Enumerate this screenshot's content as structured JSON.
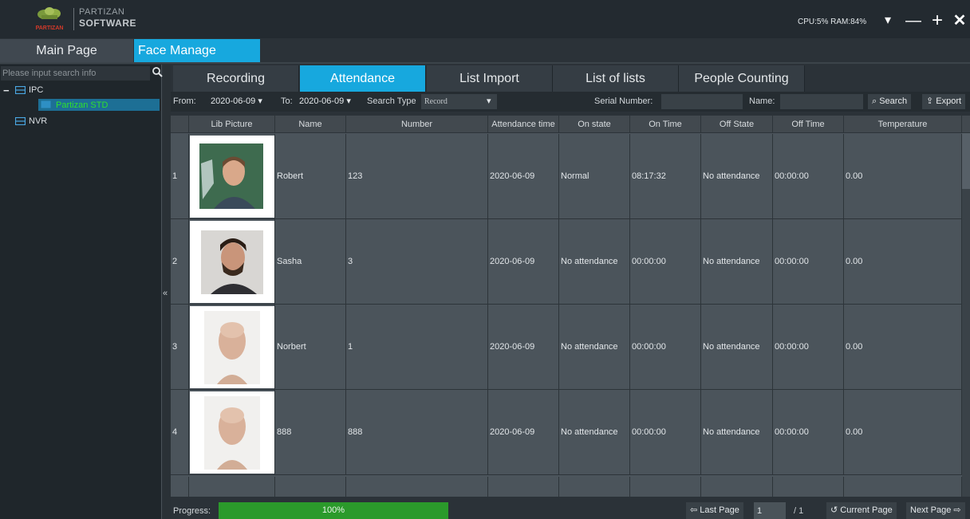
{
  "brand": {
    "line1": "PARTIZAN",
    "line2": "SOFTWARE",
    "logo_word": "PARTIZAN"
  },
  "sysinfo": "CPU:5%  RAM:84%",
  "window": {
    "menu_glyph": "▾",
    "minimize_glyph": "—",
    "maximize_glyph": "+",
    "close_glyph": "✕"
  },
  "nav": {
    "main": "Main Page",
    "face": "Face Manage"
  },
  "sidebar": {
    "search_placeholder": "Please input search info",
    "tree": [
      {
        "label": "IPC",
        "toggle": "−",
        "color": "#4aa7e2"
      },
      {
        "label": "Partizan STD",
        "color": "#2ee12e"
      },
      {
        "label": "NVR",
        "color": "#4aa7e2"
      }
    ],
    "collapse_glyph": "«"
  },
  "tabs": [
    "Recording",
    "Attendance",
    "List Import",
    "List of lists",
    "People Counting"
  ],
  "active_tab": 1,
  "filters": {
    "from_label": "From:",
    "from_value": "2020-06-09 ▾",
    "to_label": "To:",
    "to_value": "2020-06-09 ▾",
    "search_type_label": "Search Type",
    "search_type_value": "Record",
    "search_type_arrow": "▾",
    "serial_label": "Serial Number:",
    "name_label": "Name:",
    "search_button": "⌕ Search",
    "export_button": "⇪ Export"
  },
  "table": {
    "columns": [
      "Lib Picture",
      "Name",
      "Number",
      "Attendance time",
      "On state",
      "On Time",
      "Off State",
      "Off Time",
      "Temperature"
    ],
    "rows": [
      {
        "index": "1",
        "name": "Robert",
        "number": "123",
        "time": "2020-06-09",
        "on_state": "Normal",
        "on_time": "08:17:32",
        "off_state": "No attendance",
        "off_time": "00:00:00",
        "temp": "0.00"
      },
      {
        "index": "2",
        "name": "Sasha",
        "number": "3",
        "time": "2020-06-09",
        "on_state": "No attendance",
        "on_time": "00:00:00",
        "off_state": "No attendance",
        "off_time": "00:00:00",
        "temp": "0.00"
      },
      {
        "index": "3",
        "name": "Norbert",
        "number": "1",
        "time": "2020-06-09",
        "on_state": "No attendance",
        "on_time": "00:00:00",
        "off_state": "No attendance",
        "off_time": "00:00:00",
        "temp": "0.00"
      },
      {
        "index": "4",
        "name": "888",
        "number": "888",
        "time": "2020-06-09",
        "on_state": "No attendance",
        "on_time": "00:00:00",
        "off_state": "No attendance",
        "off_time": "00:00:00",
        "temp": "0.00"
      }
    ]
  },
  "footer": {
    "progress_label": "Progress:",
    "progress_value": 100,
    "progress_text": "100%",
    "last_page": "⇦ Last Page",
    "page_value": "1",
    "page_total": "/ 1",
    "current_page": "↺ Current Page",
    "next_page": "Next Page ⇨"
  },
  "colors": {
    "accent": "#17a8de",
    "progress": "#2b9a2b",
    "selected_device": "#2ee12e"
  }
}
